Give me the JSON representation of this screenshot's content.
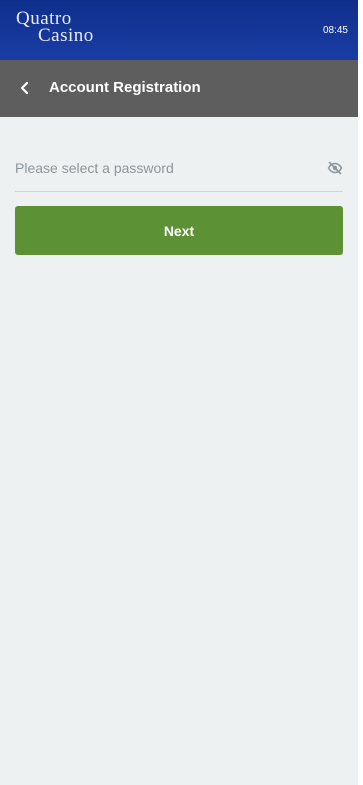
{
  "brand": {
    "line1": "Quatro",
    "line2": "Casino"
  },
  "status": {
    "time": "08:45"
  },
  "header": {
    "title": "Account Registration"
  },
  "form": {
    "password_placeholder": "Please select a password",
    "password_value": "",
    "next_label": "Next"
  },
  "colors": {
    "brand_blue": "#1a3da3",
    "header_gray": "#5e5e5e",
    "background": "#edf1f2",
    "primary_green": "#5d9136"
  },
  "icons": {
    "back": "chevron-left-icon",
    "visibility": "eye-off-icon"
  }
}
